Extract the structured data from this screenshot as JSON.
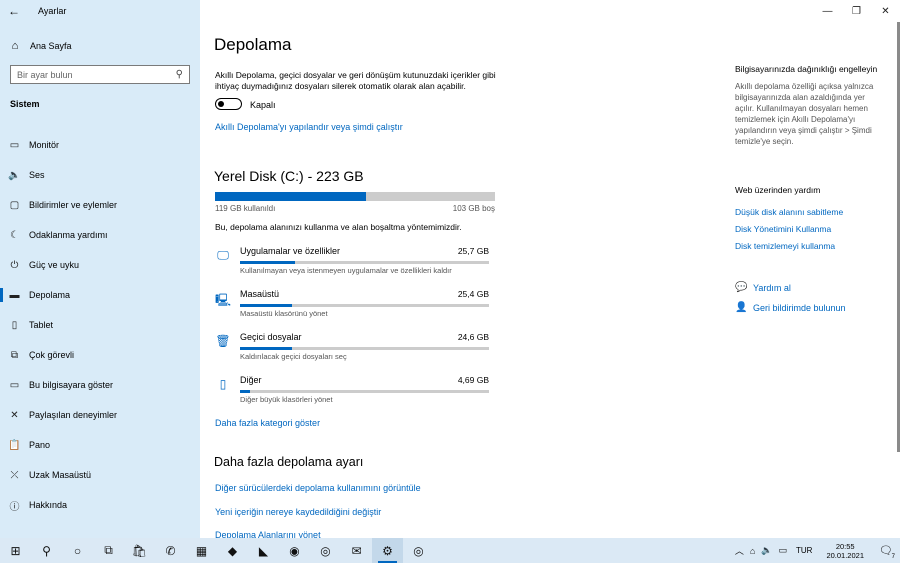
{
  "window": {
    "title": "Ayarlar",
    "back_icon": "arrow-left-icon",
    "controls": {
      "minimize": "—",
      "maximize": "❐",
      "close": "✕"
    }
  },
  "sidebar": {
    "home_label": "Ana Sayfa",
    "search_placeholder": "Bir ayar bulun",
    "section_title": "Sistem",
    "items": [
      {
        "label": "Monitör",
        "icon": "▭"
      },
      {
        "label": "Ses",
        "icon": "🔈"
      },
      {
        "label": "Bildirimler ve eylemler",
        "icon": "▢"
      },
      {
        "label": "Odaklanma yardımı",
        "icon": "☾"
      },
      {
        "label": "Güç ve uyku",
        "icon": "⏻"
      },
      {
        "label": "Depolama",
        "icon": "▬"
      },
      {
        "label": "Tablet",
        "icon": "▯"
      },
      {
        "label": "Çok görevli",
        "icon": "⧉"
      },
      {
        "label": "Bu bilgisayara göster",
        "icon": "▭"
      },
      {
        "label": "Paylaşılan deneyimler",
        "icon": "✕"
      },
      {
        "label": "Pano",
        "icon": "📋"
      },
      {
        "label": "Uzak Masaüstü",
        "icon": "⤫"
      },
      {
        "label": "Hakkında",
        "icon": "ⓘ"
      }
    ],
    "active_index": 5
  },
  "main": {
    "title": "Depolama",
    "sense_description": "Akıllı Depolama, geçici dosyalar ve geri dönüşüm kutunuzdaki içerikler gibi ihtiyaç duymadığınız dosyaları silerek otomatik olarak alan açabilir.",
    "toggle_state": "Kapalı",
    "configure_link": "Akıllı Depolama'yı yapılandır veya şimdi çalıştır",
    "disk": {
      "title": "Yerel Disk (C:) - 223 GB",
      "used_label": "119 GB kullanıldı",
      "free_label": "103 GB boş",
      "used_fraction": 0.54,
      "description": "Bu, depolama alanınızı kullanma ve alan boşaltma yöntemimizdir."
    },
    "categories": [
      {
        "name": "Uygulamalar ve özellikler",
        "size": "25,7 GB",
        "sub": "Kullanılmayan veya istenmeyen uygulamalar ve özellikleri kaldır",
        "icon": "monitor-icon",
        "glyph": "🖵",
        "fraction": 0.22
      },
      {
        "name": "Masaüstü",
        "size": "25,4 GB",
        "sub": "Masaüstü klasörünü yönet",
        "icon": "desktop-icon",
        "glyph": "🖳",
        "fraction": 0.21
      },
      {
        "name": "Geçici dosyalar",
        "size": "24,6 GB",
        "sub": "Kaldırılacak geçici dosyaları seç",
        "icon": "trash-icon",
        "glyph": "🗑",
        "fraction": 0.21
      },
      {
        "name": "Diğer",
        "size": "4,69 GB",
        "sub": "Diğer büyük klasörleri yönet",
        "icon": "folder-icon",
        "glyph": "▯",
        "fraction": 0.04
      }
    ],
    "more_categories_link": "Daha fazla kategori göster",
    "more_settings_title": "Daha fazla depolama ayarı",
    "more_links": [
      "Diğer sürücülerdeki depolama kullanımını görüntüle",
      "Yeni içeriğin nereye kaydedildiğini değiştir",
      "Depolama Alanlarını yönet"
    ]
  },
  "right": {
    "tip_title": "Bilgisayarınızda dağınıklığı engelleyin",
    "tip_description": "Akıllı depolama özelliği açıksa yalnızca bilgisayarınızda alan azaldığında yer açılır. Kullanılmayan dosyaları hemen temizlemek için Akıllı Depolama'yı yapılandırın veya şimdi çalıştır > Şimdi temizle'ye seçin.",
    "web_title": "Web üzerinden yardım",
    "web_links": [
      "Düşük disk alanını sabitleme",
      "Disk Yönetimini Kullanma",
      "Disk temizlemeyi kullanma"
    ],
    "get_help": "Yardım al",
    "feedback": "Geri bildirimde bulunun"
  },
  "taskbar": {
    "icons": [
      {
        "name": "start-icon",
        "glyph": "⊞"
      },
      {
        "name": "search-icon",
        "glyph": "⚲"
      },
      {
        "name": "cortana-icon",
        "glyph": "○"
      },
      {
        "name": "task-view-icon",
        "glyph": "⧉"
      },
      {
        "name": "store-icon",
        "glyph": "🛍"
      },
      {
        "name": "whatsapp-icon",
        "glyph": "✆"
      },
      {
        "name": "calculator-icon",
        "glyph": "▦"
      },
      {
        "name": "paint-icon",
        "glyph": "◆"
      },
      {
        "name": "app-icon",
        "glyph": "◣"
      },
      {
        "name": "zoom-icon",
        "glyph": "◉"
      },
      {
        "name": "chrome-icon",
        "glyph": "◎"
      },
      {
        "name": "mail-icon",
        "glyph": "✉"
      },
      {
        "name": "settings-icon",
        "glyph": "⚙"
      },
      {
        "name": "chrome-profile-icon",
        "glyph": "◎"
      }
    ],
    "active_index": 12,
    "language": "TUR",
    "time": "20:55",
    "date": "20.01.2021",
    "notification_count": "7"
  }
}
